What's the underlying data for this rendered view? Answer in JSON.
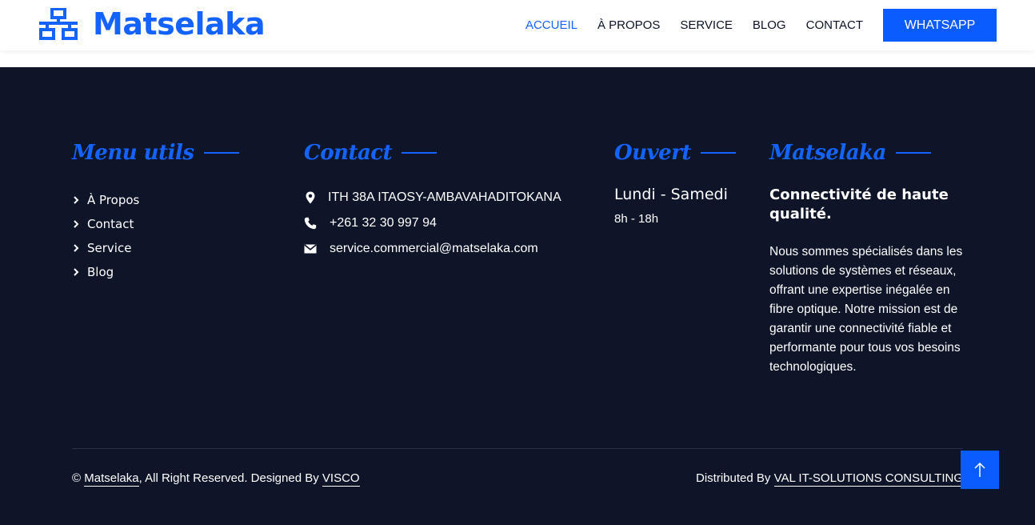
{
  "brand": {
    "name": "Matselaka",
    "icon": "network-icon",
    "color": "#1563ff"
  },
  "nav": {
    "items": [
      {
        "label": "ACCUEIL",
        "active": true
      },
      {
        "label": "À PROPOS",
        "active": false
      },
      {
        "label": "SERVICE",
        "active": false
      },
      {
        "label": "BLOG",
        "active": false
      },
      {
        "label": "CONTACT",
        "active": false
      }
    ],
    "whatsapp_label": "WHATSAPP"
  },
  "footer": {
    "background": "#0f1528",
    "menu": {
      "title": "Menu utils",
      "items": [
        {
          "label": "À Propos",
          "icon": "chevron-right-icon"
        },
        {
          "label": "Contact",
          "icon": "chevron-right-icon"
        },
        {
          "label": "Service",
          "icon": "chevron-right-icon"
        },
        {
          "label": "Blog",
          "icon": "chevron-right-icon"
        }
      ]
    },
    "contact": {
      "title": "Contact",
      "address": "ITH 38A ITAOSY-AMBAVAHADITOKANA",
      "phone": "+261 32 30 997 94",
      "email": "service.commercial@matselaka.com"
    },
    "hours": {
      "title": "Ouvert",
      "days": "Lundi - Samedi",
      "time": "8h - 18h"
    },
    "about": {
      "title": "Matselaka",
      "heading": "Connectivité de haute qualité.",
      "text": "Nous sommes spécialisés dans les solutions de systèmes et réseaux, offrant une expertise inégalée en fibre optique. Notre mission est de garantir une connectivité fiable et performante pour tous vos besoins technologiques."
    },
    "bottom": {
      "copyright_symbol": "©",
      "copyright_link": "Matselaka",
      "copyright_mid": ", All Right Reserved. Designed By",
      "designer_link": "VISCO",
      "distributed_prefix": "Distributed By",
      "distributor_link": "VAL IT-SOLUTIONS CONSULTING"
    },
    "back_to_top_icon": "arrow-up-icon"
  }
}
